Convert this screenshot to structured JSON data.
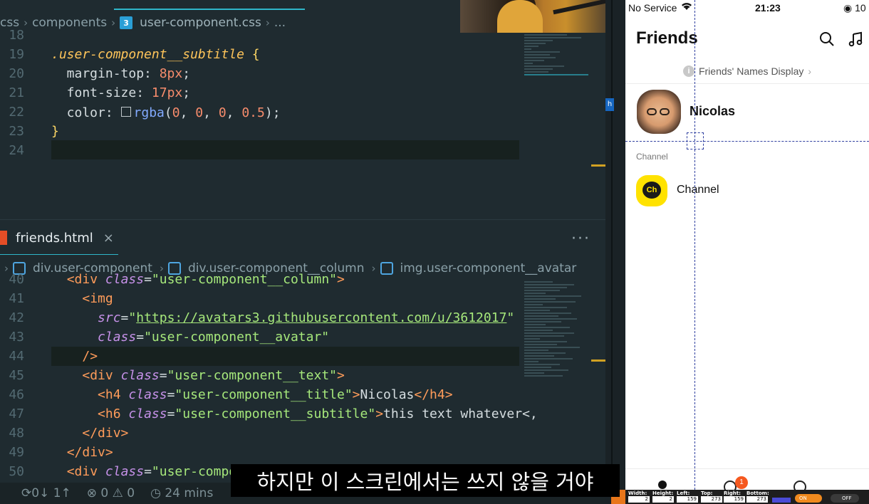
{
  "editor": {
    "top_breadcrumb": {
      "folder1": "css",
      "folder2": "components",
      "file": "user-component.css",
      "more": "..."
    },
    "css_code": [
      {
        "ln": "18",
        "tokens": []
      },
      {
        "ln": "19",
        "tokens": [
          [
            "sel",
            ".user-component__subtitle"
          ],
          [
            "punc",
            " "
          ],
          [
            "brace",
            "{"
          ]
        ]
      },
      {
        "ln": "20",
        "tokens": [
          [
            "prop",
            "  margin-top: "
          ],
          [
            "num",
            "8px"
          ],
          [
            "punc",
            ";"
          ]
        ]
      },
      {
        "ln": "21",
        "tokens": [
          [
            "prop",
            "  font-size: "
          ],
          [
            "num",
            "17px"
          ],
          [
            "punc",
            ";"
          ]
        ]
      },
      {
        "ln": "22",
        "tokens": [
          [
            "prop",
            "  color: "
          ],
          [
            "box",
            ""
          ],
          [
            "fn",
            "rgba"
          ],
          [
            "punc",
            "("
          ],
          [
            "num",
            "0"
          ],
          [
            "punc",
            ", "
          ],
          [
            "num",
            "0"
          ],
          [
            "punc",
            ", "
          ],
          [
            "num",
            "0"
          ],
          [
            "punc",
            ", "
          ],
          [
            "num",
            "0.5"
          ],
          [
            "punc",
            ");"
          ]
        ]
      },
      {
        "ln": "23",
        "tokens": [
          [
            "brace",
            "}"
          ]
        ]
      },
      {
        "ln": "24",
        "tokens": []
      }
    ],
    "html_tab": {
      "label": "friends.html",
      "close": "×",
      "more": "···"
    },
    "html_breadcrumb": [
      {
        "text": "div.user-component"
      },
      {
        "text": "div.user-component__column"
      },
      {
        "text": "img.user-component__avatar"
      }
    ],
    "html_code": [
      {
        "ln": "40",
        "tokens": [
          [
            "punc",
            "  "
          ],
          [
            "tag",
            "<div"
          ],
          [
            "punc",
            " "
          ],
          [
            "attr",
            "class"
          ],
          [
            "punc",
            "="
          ],
          [
            "str",
            "\"user-component__column\""
          ],
          [
            "tag",
            ">"
          ]
        ]
      },
      {
        "ln": "41",
        "tokens": [
          [
            "punc",
            "    "
          ],
          [
            "tag",
            "<img"
          ]
        ]
      },
      {
        "ln": "42",
        "tokens": [
          [
            "punc",
            "      "
          ],
          [
            "attr",
            "src"
          ],
          [
            "punc",
            "="
          ],
          [
            "str",
            "\""
          ],
          [
            "link",
            "https://avatars3.githubusercontent.com/u/3612017"
          ],
          [
            "str",
            "\""
          ]
        ]
      },
      {
        "ln": "43",
        "tokens": [
          [
            "punc",
            "      "
          ],
          [
            "attr",
            "class"
          ],
          [
            "punc",
            "="
          ],
          [
            "str",
            "\"user-component__avatar\""
          ]
        ]
      },
      {
        "ln": "44",
        "tokens": [
          [
            "punc",
            "    "
          ],
          [
            "tag",
            "/>"
          ]
        ]
      },
      {
        "ln": "45",
        "tokens": [
          [
            "punc",
            "    "
          ],
          [
            "tag",
            "<div"
          ],
          [
            "punc",
            " "
          ],
          [
            "attr",
            "class"
          ],
          [
            "punc",
            "="
          ],
          [
            "str",
            "\"user-component__text\""
          ],
          [
            "tag",
            ">"
          ]
        ]
      },
      {
        "ln": "46",
        "tokens": [
          [
            "punc",
            "      "
          ],
          [
            "tag",
            "<h4"
          ],
          [
            "punc",
            " "
          ],
          [
            "attr",
            "class"
          ],
          [
            "punc",
            "="
          ],
          [
            "str",
            "\"user-component__title\""
          ],
          [
            "tag",
            ">"
          ],
          [
            "punc",
            "Nicolas"
          ],
          [
            "tag",
            "</h4>"
          ]
        ]
      },
      {
        "ln": "47",
        "tokens": [
          [
            "punc",
            "      "
          ],
          [
            "tag",
            "<h6"
          ],
          [
            "punc",
            " "
          ],
          [
            "attr",
            "class"
          ],
          [
            "punc",
            "="
          ],
          [
            "str",
            "\"user-component__subtitle\""
          ],
          [
            "tag",
            ">"
          ],
          [
            "punc",
            "this text whatever<,"
          ]
        ]
      },
      {
        "ln": "48",
        "tokens": [
          [
            "punc",
            "    "
          ],
          [
            "tag",
            "</div>"
          ]
        ]
      },
      {
        "ln": "49",
        "tokens": [
          [
            "punc",
            "  "
          ],
          [
            "tag",
            "</div>"
          ]
        ]
      },
      {
        "ln": "50",
        "tokens": [
          [
            "punc",
            "  "
          ],
          [
            "tag",
            "<div"
          ],
          [
            "punc",
            " "
          ],
          [
            "attr",
            "class"
          ],
          [
            "punc",
            "="
          ],
          [
            "str",
            "\"user-compon"
          ]
        ]
      }
    ],
    "status_bar": {
      "sync": "⟳0↓ 1↑",
      "errors": "⊗ 0 ⚠ 0",
      "time": "◷ 24 mins"
    }
  },
  "phone": {
    "carrier": "No Service",
    "time": "21:23",
    "battery": "◉ 10",
    "title": "Friends",
    "notice": "Friends' Names Display",
    "user_name": "Nicolas",
    "section_label": "Channel",
    "channel_name": "Channel",
    "channel_icon_text": "Ch",
    "chat_badge": "1"
  },
  "measure": {
    "width_label": "Width:",
    "width": "2",
    "height_label": "Height:",
    "height": "2",
    "left_label": "Left:",
    "left": "159",
    "top_label": "Top:",
    "top": "273",
    "right_label": "Right:",
    "right": "159",
    "bottom_label": "Bottom:",
    "bottom": "273",
    "on": "ON",
    "off": "OFF"
  },
  "subtitle": "하지만 이 스크린에서는 쓰지 않을 거야",
  "colors": {
    "editor_bg": "#1f2b30",
    "accent": "#2fb6c9",
    "selector": "#ffc55a",
    "number": "#f78c6c",
    "tag": "#ff9c5a",
    "string": "#a6e87b",
    "kakao_yellow": "#ffe200"
  }
}
